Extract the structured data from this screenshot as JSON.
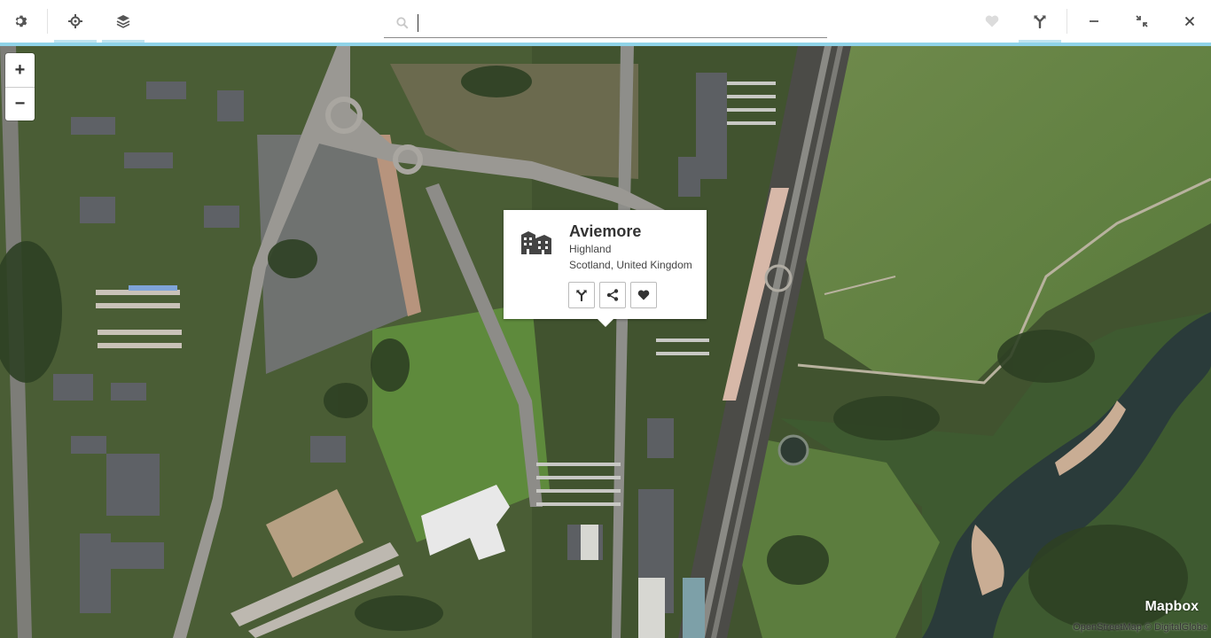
{
  "toolbar": {
    "left_buttons": [
      {
        "name": "settings",
        "icon": "gear-icon"
      },
      {
        "name": "locate",
        "icon": "crosshair-icon"
      },
      {
        "name": "layers",
        "icon": "layers-icon"
      }
    ],
    "right_buttons": [
      {
        "name": "favorite",
        "icon": "heart-icon"
      },
      {
        "name": "directions",
        "icon": "directions-icon"
      }
    ],
    "window_buttons": [
      {
        "name": "minimize",
        "icon": "minimize-icon"
      },
      {
        "name": "restore",
        "icon": "restore-icon"
      },
      {
        "name": "close",
        "icon": "close-icon"
      }
    ],
    "accent_color": "#8fd3e8"
  },
  "search": {
    "icon": "search-icon",
    "value": "",
    "placeholder": ""
  },
  "map": {
    "zoom_in_label": "+",
    "zoom_out_label": "−"
  },
  "popup": {
    "name": "Aviemore",
    "region": "Highland",
    "country": "Scotland, United Kingdom",
    "icon": "city-icon",
    "actions": [
      {
        "name": "directions",
        "icon": "directions-icon"
      },
      {
        "name": "share",
        "icon": "share-icon"
      },
      {
        "name": "favorite",
        "icon": "heart-icon"
      }
    ]
  },
  "branding": {
    "logo_text": "Mapbox",
    "attribution": "OpenStreetMap © DigitalGlobe"
  }
}
